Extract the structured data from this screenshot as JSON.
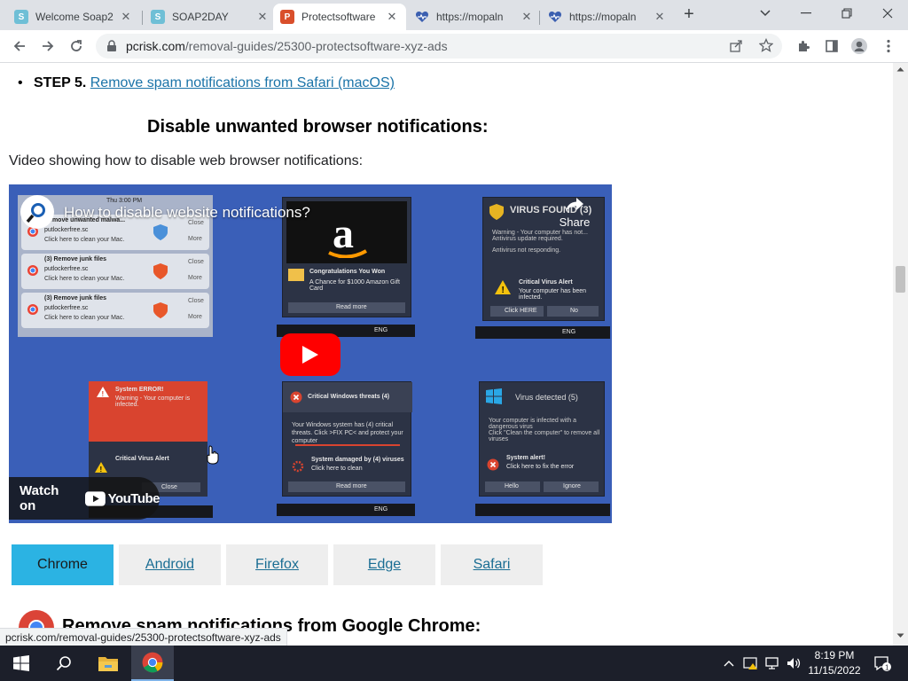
{
  "browser": {
    "tabs": [
      {
        "title": "Welcome Soap2",
        "favicon_letter": "S",
        "favicon_color": "#6fbfd6"
      },
      {
        "title": "SOAP2DAY",
        "favicon_letter": "S",
        "favicon_color": "#6fbfd6"
      },
      {
        "title": "Protectsoftware",
        "favicon_letter": "P",
        "favicon_color": "#d94f2b"
      },
      {
        "title": "https://mopaln",
        "favicon_letter": "",
        "favicon_color": "#3b5fb0"
      },
      {
        "title": "https://mopaln",
        "favicon_letter": "",
        "favicon_color": "#3b5fb0"
      }
    ],
    "active_tab_index": 2,
    "url_domain": "pcrisk.com",
    "url_path": "/removal-guides/25300-protectsoftware-xyz-ads"
  },
  "page": {
    "step_label": "STEP 5.",
    "step_link": "Remove spam notifications from Safari (macOS)",
    "heading": "Disable unwanted browser notifications:",
    "video_caption": "Video showing how to disable web browser notifications:",
    "video": {
      "title": "How to disable website notifications?",
      "share_label": "Share",
      "watch_on": "Watch on",
      "youtube": "YouTube",
      "thumbnail_text": {
        "mac_time": "Thu 3:00 PM",
        "mac_notif1_title": "Remove unwanted malwa...",
        "mac_notif1_site": "putlockerfree.sc",
        "mac_notif1_body": "Click here to clean your Mac.",
        "mac_notif_title": "(3) Remove junk files",
        "mac_notif_site": "putlockerfree.sc",
        "mac_notif_body": "Click here to clean your Mac.",
        "mac_close": "Close",
        "mac_more": "More",
        "amazon_congrats": "Congratulations You Won",
        "amazon_body": "A Chance for $1000 Amazon Gift Card",
        "amazon_read": "Read more",
        "virus_found": "VIRUS FOUND (3)",
        "virus_warning": "Warning - Your computer has not... Antivirus update required.",
        "virus_notresp": "Antivirus not responding.",
        "critical_alert": "Critical Virus Alert",
        "critical_body": "Your computer has been infected.",
        "click_here": "Click HERE",
        "no_btn": "No",
        "sys_error": "System ERROR!",
        "sys_warning": "Warning - Your computer is infected.",
        "cw_threats": "Critical Windows threats (4)",
        "cw_body": "Your Windows system has (4) critical threats. Click >FIX PC< and protect your computer",
        "sys_damaged": "System damaged by (4) viruses",
        "sys_damaged_sub": "Click here to clean",
        "virus_detected": "Virus detected (5)",
        "vd_body": "Your computer is infected with a dangerous virus",
        "vd_body2": "Click \"Clean the computer\" to remove all viruses",
        "sys_alert": "System alert!",
        "sys_alert_sub": "Click here to fix the error",
        "hello_btn": "Hello",
        "ignore_btn": "Ignore",
        "close_btn": "Close",
        "eng": "ENG",
        "read_more": "Read more"
      }
    },
    "platform_tabs": [
      "Chrome",
      "Android",
      "Firefox",
      "Edge",
      "Safari"
    ],
    "active_platform": "Chrome",
    "section_title": "Remove spam notifications from Google Chrome:",
    "status_url": "pcrisk.com/removal-guides/25300-protectsoftware-xyz-ads"
  },
  "taskbar": {
    "time": "8:19 PM",
    "date": "11/15/2022",
    "notification_count": "1"
  },
  "colors": {
    "accent_tab": "#2bb3e3",
    "link": "#1a73a8",
    "video_bg": "#3a5fb8",
    "youtube_red": "#ff0000",
    "taskbar": "#1c1f2a"
  }
}
